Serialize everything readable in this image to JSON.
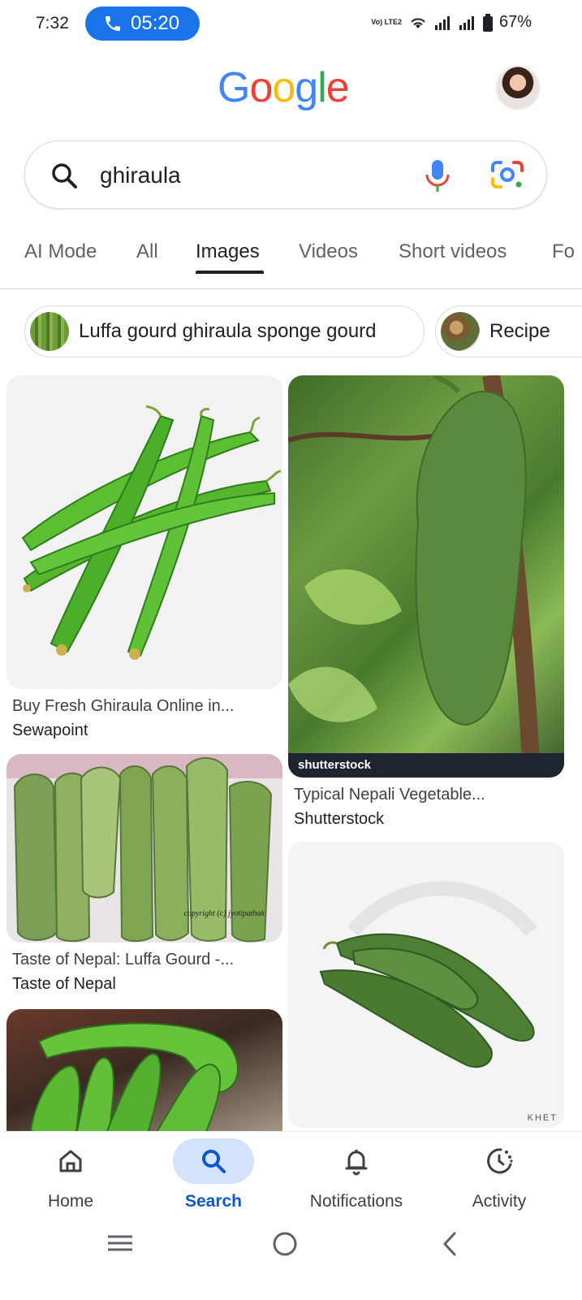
{
  "status_bar": {
    "time": "7:32",
    "call_duration": "05:20",
    "volte_label": "Vo) LTE2",
    "battery": "67%"
  },
  "header": {
    "logo_text": "Google",
    "logo_colors": [
      "#4285F4",
      "#EA4335",
      "#FBBC05",
      "#4285F4",
      "#34A853",
      "#EA4335"
    ]
  },
  "search": {
    "query": "ghiraula"
  },
  "tabs": [
    {
      "label": "AI Mode"
    },
    {
      "label": "All"
    },
    {
      "label": "Images",
      "active": true
    },
    {
      "label": "Videos"
    },
    {
      "label": "Short videos"
    },
    {
      "label": "Fo"
    }
  ],
  "chips": [
    {
      "label": "Luffa gourd ghiraula sponge gourd"
    },
    {
      "label": "Recipe"
    }
  ],
  "results": [
    {
      "title": "Buy Fresh Ghiraula Online in...",
      "source": "Sewapoint"
    },
    {
      "title": "Typical Nepali Vegetable...",
      "source": "Shutterstock",
      "watermark": "shutterstock"
    },
    {
      "title": "Taste of Nepal: Luffa Gourd -...",
      "source": "Taste of Nepal",
      "overlay": "copyright (c) jyotipathak"
    },
    {
      "overlay": "KHET"
    },
    {}
  ],
  "bottom_nav": [
    {
      "label": "Home",
      "icon": "home-icon"
    },
    {
      "label": "Search",
      "icon": "search-icon",
      "active": true
    },
    {
      "label": "Notifications",
      "icon": "bell-icon"
    },
    {
      "label": "Activity",
      "icon": "activity-icon"
    }
  ],
  "colors": {
    "accent": "#1a73e8",
    "active_nav_bg": "#d3e3fd",
    "active_nav_text": "#0b57d0"
  }
}
